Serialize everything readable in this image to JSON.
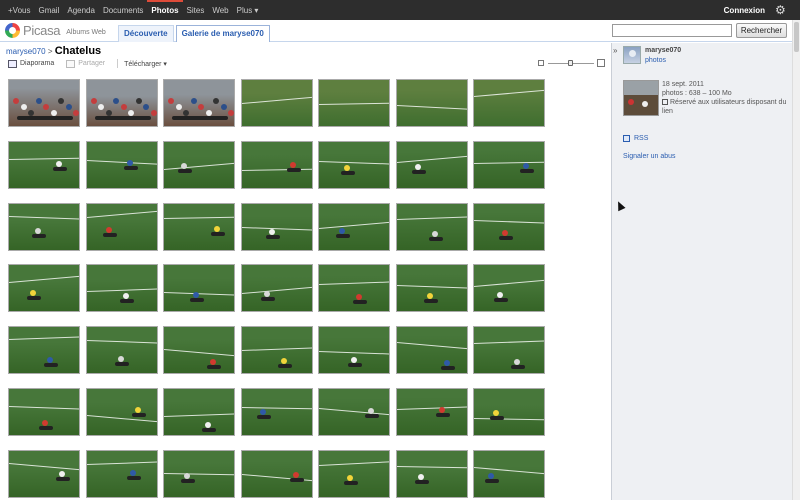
{
  "topnav": {
    "items": [
      "+Vous",
      "Gmail",
      "Agenda",
      "Documents",
      "Photos",
      "Sites",
      "Web",
      "Plus ▾"
    ],
    "active_index": 4,
    "connexion": "Connexion"
  },
  "header": {
    "logo_text": "Picasa",
    "logo_sub": "Albums Web",
    "tabs": [
      {
        "label": "Découverte",
        "active": false
      },
      {
        "label": "Galerie de maryse070",
        "active": true
      }
    ],
    "search_placeholder": "",
    "search_button": "Rechercher"
  },
  "breadcrumb": {
    "owner": "maryse070",
    "separator": ">",
    "album": "Chatelus"
  },
  "toolbar": {
    "slideshow": "Diaporama",
    "share": "Partager",
    "download": "Télécharger ▾"
  },
  "sidepane": {
    "collapse": "»",
    "owner": "maryse070",
    "owner_link": "photos",
    "date": "18 sept. 2011",
    "stats": "photos : 638 – 100 Mo",
    "access": "Réservé aux utilisateurs disposant du lien",
    "rss": "RSS",
    "report": "Signaler un abus"
  },
  "colors": {
    "topbar": "#2d2d2d",
    "link": "#2a5db0",
    "grass": "#3f7a31"
  },
  "photos": {
    "rows": 7,
    "cols": 7,
    "themes": [
      "crowd",
      "crowd",
      "crowd",
      "field",
      "field",
      "field",
      "field",
      "rider",
      "rider",
      "rider",
      "rider",
      "rider",
      "rider",
      "rider",
      "rider",
      "rider",
      "rider",
      "rider",
      "rider",
      "rider",
      "rider",
      "rider",
      "rider",
      "rider",
      "rider",
      "rider",
      "rider",
      "rider",
      "rider",
      "rider",
      "rider",
      "rider",
      "rider",
      "rider",
      "rider",
      "rider",
      "rider",
      "rider",
      "rider",
      "rider",
      "rider",
      "rider",
      "rider",
      "rider",
      "rider",
      "rider",
      "rider",
      "rider",
      "rider"
    ]
  }
}
